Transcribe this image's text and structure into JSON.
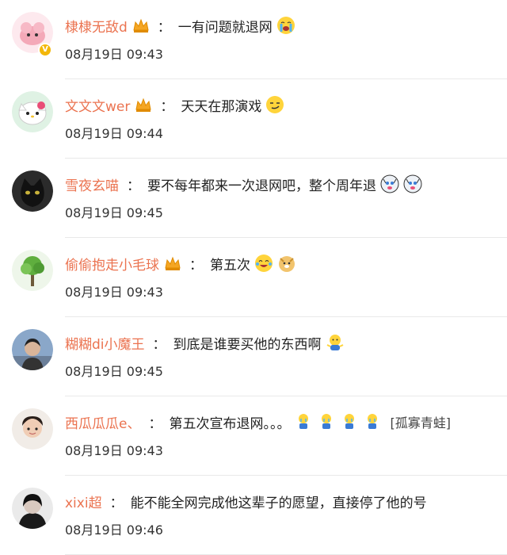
{
  "comments": [
    {
      "username": "棣棣无敌d",
      "crown": true,
      "verified": true,
      "text": "一有问题就退网",
      "emojis": [
        "crying-face-emoji"
      ],
      "tag": "",
      "time": "08月19日 09:43"
    },
    {
      "username": "文文文wer",
      "crown": true,
      "verified": false,
      "text": "天天在那演戏",
      "emojis": [
        "smirk-face-emoji"
      ],
      "tag": "",
      "time": "08月19日 09:44"
    },
    {
      "username": "雪夜玄喵",
      "crown": false,
      "verified": false,
      "text": "要不每年都来一次退网吧，整个周年退",
      "emojis": [
        "husky-emoji",
        "husky-emoji"
      ],
      "tag": "",
      "time": "08月19日 09:45"
    },
    {
      "username": "偷偷抱走小毛球",
      "crown": true,
      "verified": false,
      "text": "第五次",
      "emojis": [
        "laugh-cry-emoji",
        "doge-emoji"
      ],
      "tag": "",
      "time": "08月19日 09:43"
    },
    {
      "username": "糊糊di小魔王",
      "crown": false,
      "verified": false,
      "text": "到底是谁要买他的东西啊",
      "emojis": [
        "shrug-emoji"
      ],
      "tag": "",
      "time": "08月19日 09:45"
    },
    {
      "username": "西瓜瓜瓜e、",
      "crown": false,
      "verified": false,
      "text": "第五次宣布退网。。。",
      "emojis": [
        "sitting-cry-emoji",
        "sitting-cry-emoji",
        "sitting-cry-emoji",
        "sitting-cry-emoji"
      ],
      "tag": "[孤寡青蛙]",
      "time": "08月19日 09:43"
    },
    {
      "username": "xixi超",
      "crown": false,
      "verified": false,
      "text": "能不能全网完成他这辈子的愿望，直接停了他的号",
      "emojis": [],
      "tag": "",
      "time": "08月19日 09:46"
    }
  ],
  "colon": "：",
  "verified_mark": "V",
  "colors": {
    "username": "#eb7350",
    "text": "#222222",
    "crown": "#f5a623",
    "verified": "#f3b70b"
  }
}
